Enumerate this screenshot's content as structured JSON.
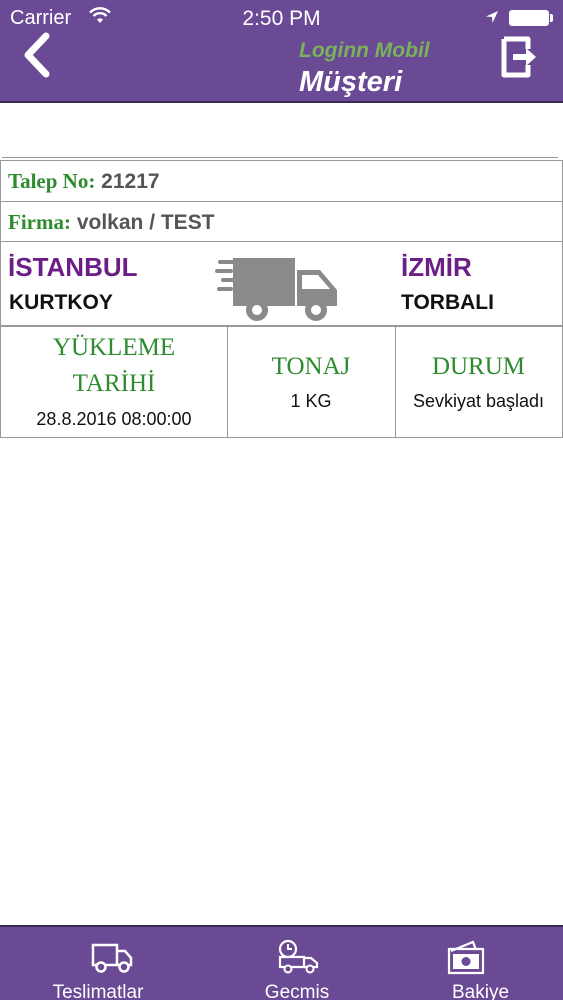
{
  "status_bar": {
    "carrier": "Carrier",
    "time": "2:50 PM"
  },
  "header": {
    "brand": "Loginn Mobil",
    "title": "Müşteri",
    "back_icon": "chevron-left-icon",
    "logout_icon": "logout-icon"
  },
  "request": {
    "talep_label": "Talep No:",
    "talep_value": "21217",
    "firma_label": "Firma:",
    "firma_value": "volkan / TEST",
    "origin_city": "İSTANBUL",
    "origin_district": "KURTKOY",
    "destination_city": "İZMİR",
    "destination_district": "TORBALI",
    "truck_icon": "delivery-truck-icon",
    "details": [
      {
        "label_line1": "YÜKLEME",
        "label_line2": "TARİHİ",
        "value": "28.8.2016 08:00:00"
      },
      {
        "label": "TONAJ",
        "value": "1 KG"
      },
      {
        "label": "DURUM",
        "value": "Sevkiyat başladı"
      }
    ]
  },
  "tabs": [
    {
      "label": "Teslimatlar",
      "icon": "truck-icon"
    },
    {
      "label": "Gecmis",
      "icon": "history-truck-icon"
    },
    {
      "label": "Bakiye",
      "icon": "cash-icon"
    }
  ],
  "colors": {
    "header_bg": "#6a4a94",
    "brand_green": "#78b25a",
    "label_green": "#2e8b2e",
    "city_purple": "#6b1f86"
  }
}
